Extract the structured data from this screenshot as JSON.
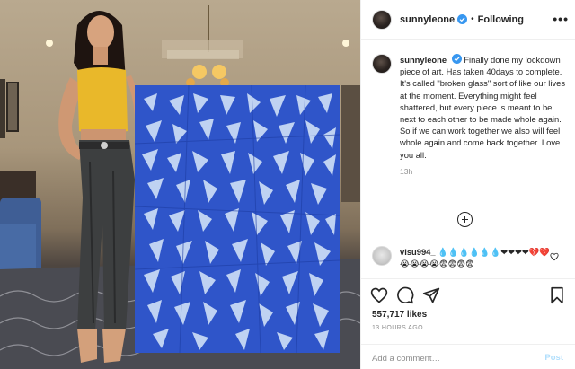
{
  "post": {
    "author": "sunnyleone",
    "follow_state": "Following",
    "more_glyph": "•••",
    "caption": "Finally done my lockdown piece of art. Has taken 40days to complete. It's called \"broken glass\" sort of like our lives at the moment. Everything might feel shattered, but every piece is meant to be next to each other to be made whole again. So if we can work together we also will feel whole again and come back together. Love you all.",
    "caption_age": "13h",
    "likes": "557,717 likes",
    "posted_ago": "13 HOURS AGO"
  },
  "comment": {
    "user": "visu994_",
    "text": "💧💧💧💧💧💧❤❤❤❤💔💔😭😭😭😭😨😨😨😨"
  },
  "add_comment": {
    "placeholder": "Add a comment…",
    "post_label": "Post"
  },
  "colors": {
    "verified": "#3897f0",
    "muted": "#8e8e8e",
    "text": "#262626",
    "post_disabled": "#b2dffc",
    "painting_blue": "#2f55c9"
  },
  "icons": [
    "verified-badge-icon",
    "more-options-icon",
    "load-more-icon",
    "heart-icon",
    "comment-icon",
    "share-icon",
    "save-bookmark-icon",
    "comment-like-icon"
  ]
}
